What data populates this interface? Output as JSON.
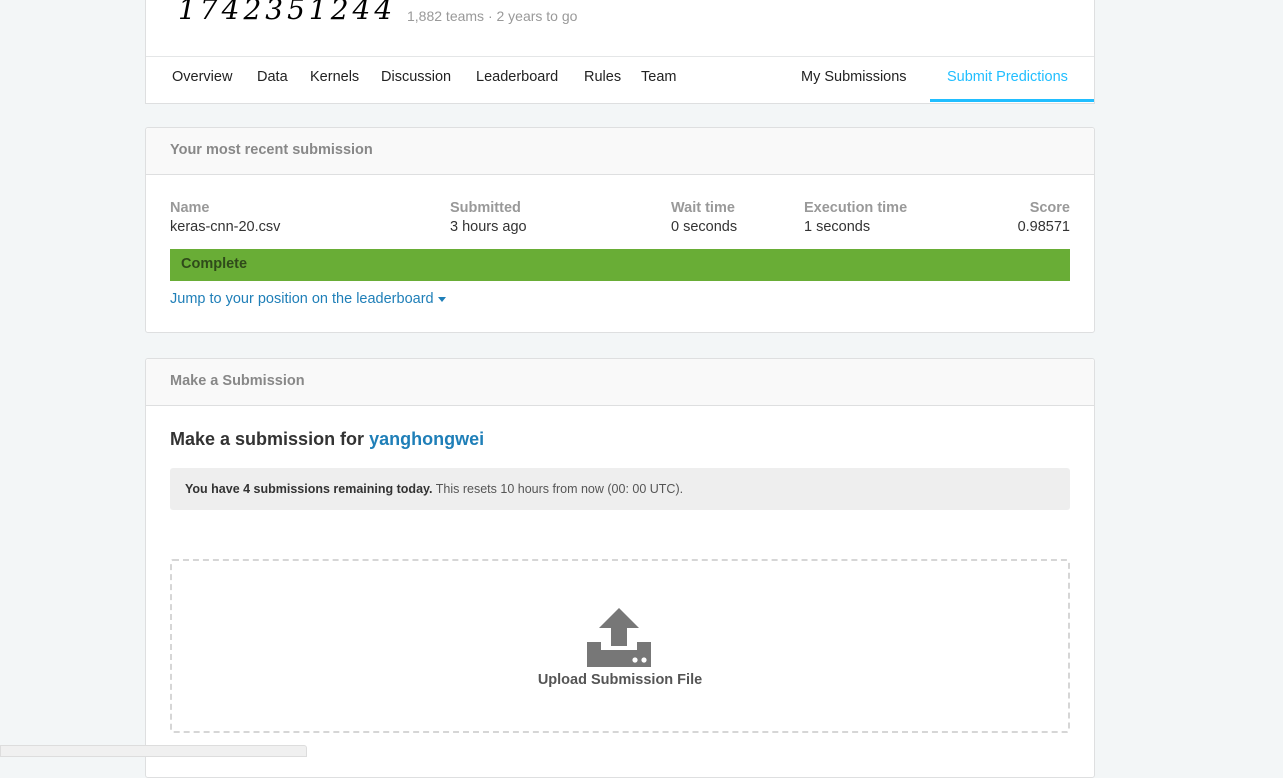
{
  "header": {
    "banner_digits": "1742351244",
    "meta": "1,882 teams · 2 years to go"
  },
  "tabs": [
    {
      "label": "Overview"
    },
    {
      "label": "Data"
    },
    {
      "label": "Kernels"
    },
    {
      "label": "Discussion"
    },
    {
      "label": "Leaderboard"
    },
    {
      "label": "Rules"
    },
    {
      "label": "Team"
    },
    {
      "label": "My Submissions"
    },
    {
      "label": "Submit Predictions"
    }
  ],
  "recent": {
    "heading": "Your most recent submission",
    "columns": {
      "name": {
        "label": "Name",
        "value": "keras-cnn-20.csv"
      },
      "submitted": {
        "label": "Submitted",
        "value": "3 hours ago"
      },
      "wait": {
        "label": "Wait time",
        "value": "0 seconds"
      },
      "execution": {
        "label": "Execution time",
        "value": "1 seconds"
      },
      "score": {
        "label": "Score",
        "value": "0.98571"
      }
    },
    "status": "Complete",
    "status_color": "#69ad36",
    "jump_link": "Jump to your position on the leaderboard"
  },
  "make": {
    "heading": "Make a Submission",
    "title_prefix": "Make a submission for",
    "username": "yanghongwei",
    "notice_bold": "You have 4 submissions remaining today.",
    "notice_rest": " This resets 10 hours from now (00: 00 UTC).",
    "upload_label": "Upload Submission File"
  },
  "colors": {
    "accent": "#20beff",
    "link": "#1f7fb8"
  }
}
